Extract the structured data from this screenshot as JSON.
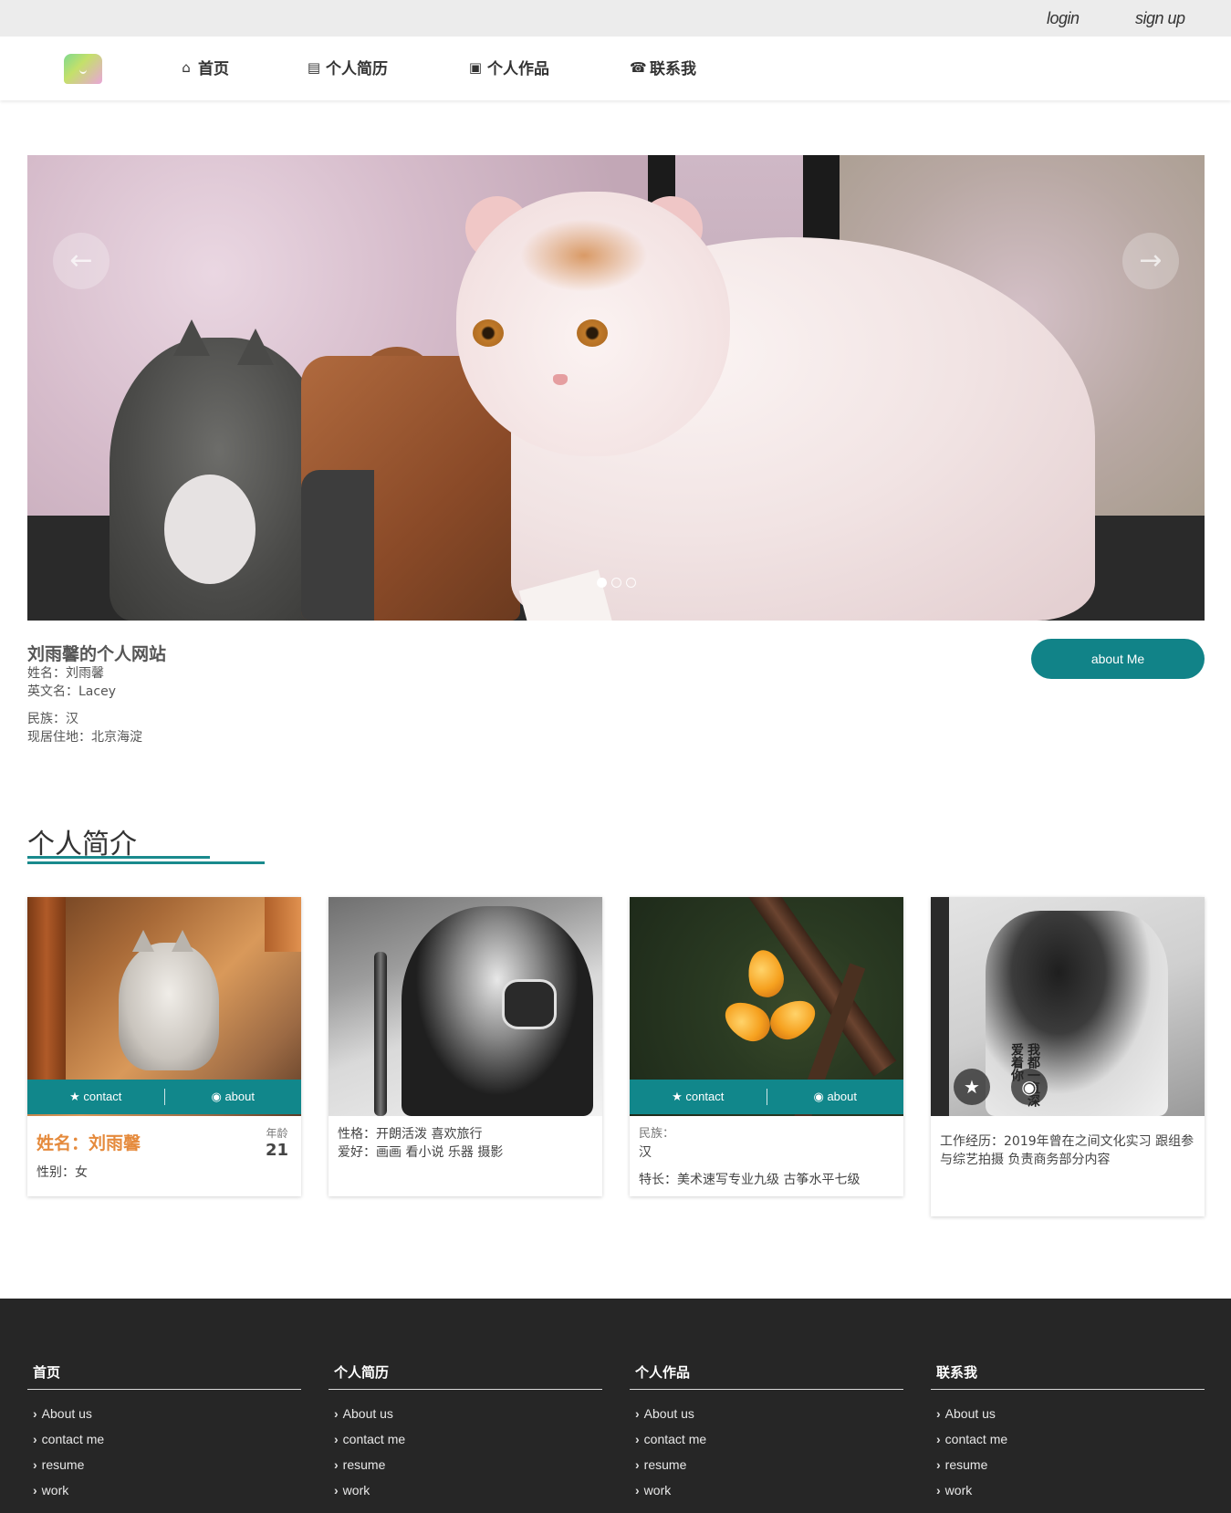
{
  "topbar": {
    "login": "login",
    "signup": "sign up"
  },
  "nav": {
    "items": [
      {
        "label": "首页",
        "icon": "home-icon",
        "glyph": "⌂"
      },
      {
        "label": "个人简历",
        "icon": "list-icon",
        "glyph": "▤"
      },
      {
        "label": "个人作品",
        "icon": "picture-icon",
        "glyph": "▣"
      },
      {
        "label": "联系我",
        "icon": "phone-icon",
        "glyph": "☎"
      }
    ]
  },
  "carousel": {
    "prev": "←",
    "next": "→",
    "slides": 3,
    "active_slide": 1
  },
  "intro": {
    "title": "刘雨馨的个人网站",
    "lines": [
      "姓名：刘雨馨",
      "英文名：Lacey",
      "民族：汉",
      "现居住地：北京海淀"
    ],
    "button": "about Me"
  },
  "section": {
    "title": "个人简介"
  },
  "cards": [
    {
      "actions": {
        "contact": "contact",
        "about": "about"
      },
      "name": "姓名：刘雨馨",
      "age_label": "年龄",
      "age": "21",
      "line": "性别：女"
    },
    {
      "lines": [
        "性格：开朗活泼 喜欢旅行",
        "爱好：画画 看小说 乐器 摄影"
      ]
    },
    {
      "actions": {
        "contact": "contact",
        "about": "about"
      },
      "label": "民族：",
      "value": "汉",
      "line": "特长：美术速写专业九级 古筝水平七级"
    },
    {
      "art_text": "我都一直深爱着你",
      "text": "工作经历：2019年曾在之间文化实习 跟组参与综艺拍摄 负责商务部分内容"
    }
  ],
  "footer": {
    "columns": [
      {
        "title": "首页",
        "links": [
          "About us",
          "contact me",
          "resume",
          "work"
        ]
      },
      {
        "title": "个人简历",
        "links": [
          "About us",
          "contact me",
          "resume",
          "work"
        ]
      },
      {
        "title": "个人作品",
        "links": [
          "About us",
          "contact me",
          "resume",
          "work"
        ]
      },
      {
        "title": "联系我",
        "links": [
          "About us",
          "contact me",
          "resume",
          "work"
        ]
      }
    ]
  },
  "colors": {
    "accent": "#118388",
    "name": "#e58a3c",
    "footer": "#262626"
  }
}
